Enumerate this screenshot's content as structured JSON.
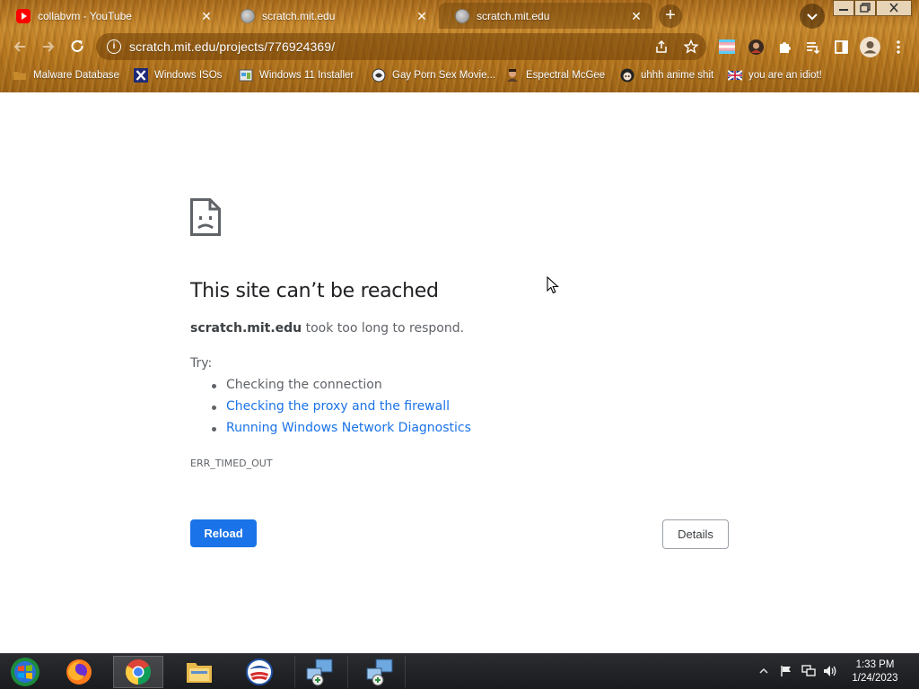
{
  "tabs": [
    {
      "title": "collabvm - YouTube",
      "favicon": "youtube-icon",
      "active": false
    },
    {
      "title": "scratch.mit.edu",
      "favicon": "globe-icon",
      "active": false
    },
    {
      "title": "scratch.mit.edu",
      "favicon": "globe-icon",
      "active": true
    }
  ],
  "toolbar": {
    "url": "scratch.mit.edu/projects/776924369/"
  },
  "bookmarks": [
    {
      "label": "Malware Database",
      "icon": "folder-icon"
    },
    {
      "label": "Windows ISOs",
      "icon": "x-logo-icon"
    },
    {
      "label": "Windows 11 Installer",
      "icon": "installer-icon"
    },
    {
      "label": "Gay Porn Sex Movie...",
      "icon": "site-icon"
    },
    {
      "label": "Espectral McGee",
      "icon": "avatar-icon"
    },
    {
      "label": "uhhh anime shit",
      "icon": "anime-icon"
    },
    {
      "label": "you are an idiot!",
      "icon": "flag-icon"
    }
  ],
  "error": {
    "title": "This site can’t be reached",
    "host": "scratch.mit.edu",
    "message": " took too long to respond.",
    "try_label": "Try:",
    "suggestions": [
      {
        "text": "Checking the connection",
        "link": false
      },
      {
        "text": "Checking the proxy and the firewall",
        "link": true
      },
      {
        "text": "Running Windows Network Diagnostics",
        "link": true
      }
    ],
    "code": "ERR_TIMED_OUT",
    "reload_label": "Reload",
    "details_label": "Details"
  },
  "taskbar": {
    "apps": [
      "start-orb-icon",
      "firefox-icon",
      "chrome-icon",
      "file-explorer-icon",
      "obama-logo-icon",
      "network-setup-icon",
      "network-setup-icon"
    ],
    "time": "1:33 PM",
    "date": "1/24/2023"
  },
  "colors": {
    "accent": "#1a73e8",
    "chrome_theme": "#b8781f",
    "taskbar": "#1f2023"
  }
}
